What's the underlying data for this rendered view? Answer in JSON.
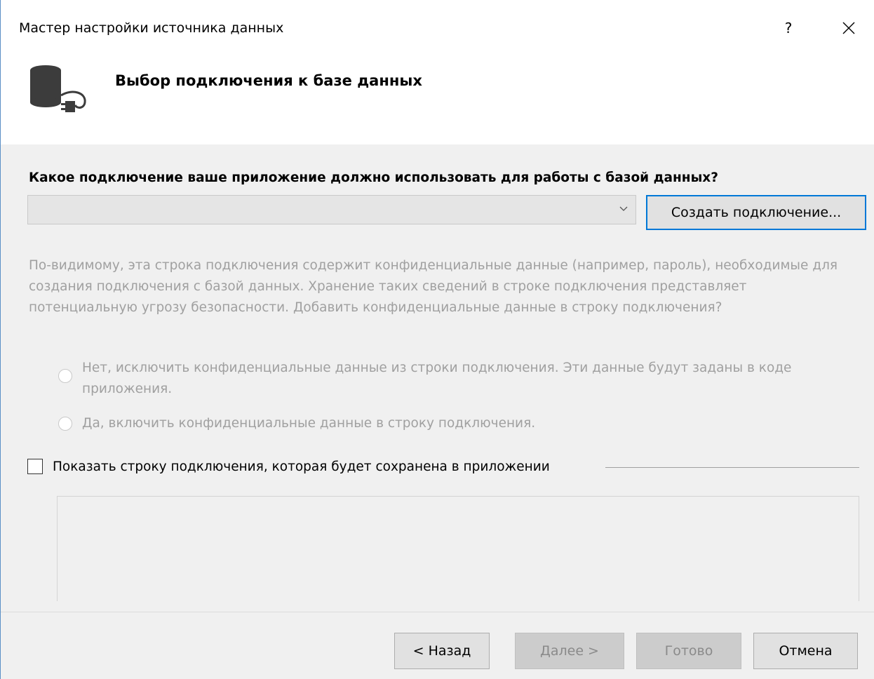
{
  "window": {
    "title": "Мастер настройки источника данных",
    "help_label": "?",
    "accent": "#0078d7"
  },
  "header": {
    "icon": "database-plug-icon",
    "title": "Выбор подключения к базе данных"
  },
  "connection": {
    "question": "Какое подключение ваше приложение должно использовать для работы с базой данных?",
    "selected_value": "",
    "create_button": "Создать подключение..."
  },
  "sensitive": {
    "warning": "По-видимому, эта строка подключения содержит конфиденциальные данные (например, пароль), необходимые для создания подключения с базой данных. Хранение таких сведений в строке подключения представляет потенциальную угрозу безопасности. Добавить конфиденциальные данные в строку подключения?",
    "option_no": "Нет, исключить конфиденциальные данные из строки подключения. Эти данные будут заданы в коде приложения.",
    "option_yes": "Да, включить конфиденциальные данные в строку подключения."
  },
  "show_string": {
    "label": "Показать строку подключения, которая будет сохранена в приложении",
    "checked": false,
    "value": ""
  },
  "footer": {
    "back": "< Назад",
    "next": "Далее >",
    "finish": "Готово",
    "cancel": "Отмена"
  }
}
